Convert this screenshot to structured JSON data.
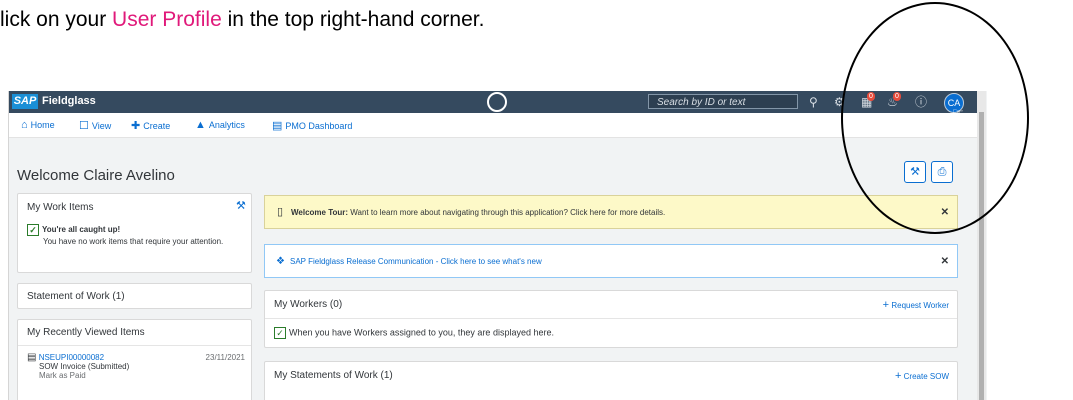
{
  "instruction": {
    "prefix": "lick on your ",
    "highlight": "User Profile",
    "suffix": " in the top right-hand corner."
  },
  "shellbar": {
    "logo": "SAP",
    "product": "Fieldglass",
    "search_placeholder": "Search by ID or text",
    "notification_badge_1": "0",
    "notification_badge_2": "0",
    "avatar_initials": "CA"
  },
  "nav": {
    "home": "Home",
    "view": "View",
    "create": "Create",
    "analytics": "Analytics",
    "pmo": "PMO Dashboard"
  },
  "welcome": "Welcome Claire Avelino",
  "work_items": {
    "title": "My Work Items",
    "caught_up": "You're all caught up!",
    "message": "You have no work items that require your attention."
  },
  "sow_card": {
    "title": "Statement of Work (1)"
  },
  "recent": {
    "title": "My Recently Viewed Items",
    "item_id": "NSEUPI00000082",
    "item_date": "23/11/2021",
    "item_type": "SOW Invoice (Submitted)",
    "item_action": "Mark as Paid"
  },
  "tour": {
    "label": "Welcome Tour:",
    "text": " Want to learn more about navigating through this application? Click here for more details."
  },
  "release": {
    "text": "SAP Fieldglass Release Communication - Click here to see what's new"
  },
  "workers": {
    "title": "My Workers (0)",
    "action": "Request Worker",
    "empty": "When you have Workers assigned to you, they are displayed here."
  },
  "statements": {
    "title": "My Statements of Work (1)",
    "action": "Create SOW"
  }
}
